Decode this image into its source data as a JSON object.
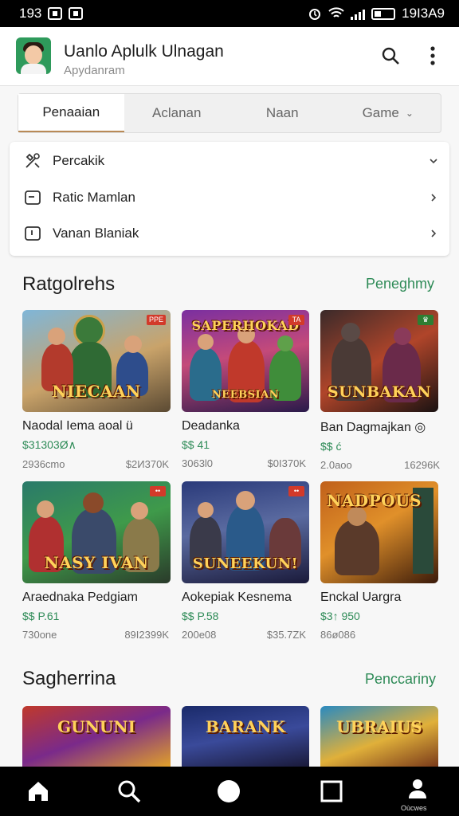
{
  "status_bar": {
    "time_left": "193",
    "time_right": "19I3A9"
  },
  "app_bar": {
    "title": "Uanlo Aplulk Ulnagan",
    "subtitle": "Apydanram"
  },
  "tabs": [
    {
      "label": "Penaaian",
      "active": true
    },
    {
      "label": "Aclanan",
      "active": false
    },
    {
      "label": "Naan",
      "active": false
    },
    {
      "label": "Game",
      "active": false,
      "dropdown": true
    }
  ],
  "menu": [
    {
      "label": "Percakik",
      "icon": "tools-icon"
    },
    {
      "label": "Ratic Mamlan",
      "icon": "media-icon"
    },
    {
      "label": "Vanan Blaniak",
      "icon": "tablet-icon"
    }
  ],
  "section1": {
    "title": "Ratgolrehs",
    "link": "Peneghmy"
  },
  "section2": {
    "title": "Sagherrina",
    "link": "Penccariny"
  },
  "games": [
    {
      "name": "Naodal Iema aoal ü",
      "price": "$31303Ø∧",
      "downloads": "2936cmo",
      "size": "$2И370K",
      "banner": "NIECAAN",
      "badge": "РРЕ"
    },
    {
      "name": "Deadanka",
      "price": "$$ 41",
      "downloads": "3063l0",
      "size": "$0I370K",
      "banner": "NEEBSIAN",
      "badge": "TA"
    },
    {
      "name": "Ban Dagmajkan ◎",
      "price": "$$ ć",
      "downloads": "2.0aoo",
      "size": "16296K",
      "banner": "SUNBAKAN",
      "badge": "♛"
    },
    {
      "name": "Araednaka Pedgiam",
      "price": "$$ P.61",
      "downloads": "730one",
      "size": "89I2399K",
      "banner": "NASY IVAN",
      "badge": "••"
    },
    {
      "name": "Aokepiak Kesnema",
      "price": "$$ P.58",
      "downloads": "200e08",
      "size": "$35.7ZK",
      "banner": "SUNEEKUN!",
      "badge": "••"
    },
    {
      "name": "Enckal Uargra",
      "price": "$3↑ 950",
      "downloads": "86ø086",
      "size": "",
      "banner": "NADPOUS",
      "badge": ""
    }
  ],
  "partials": [
    {
      "banner": "GUNUNI"
    },
    {
      "banner": "BARANK"
    },
    {
      "banner": "UBRAIUS"
    }
  ],
  "nav": {
    "profile_label": "Oùcwes"
  },
  "colors": {
    "accent": "#2e8b57",
    "tab_indicator": "#b98a56",
    "bars": "#000000"
  }
}
